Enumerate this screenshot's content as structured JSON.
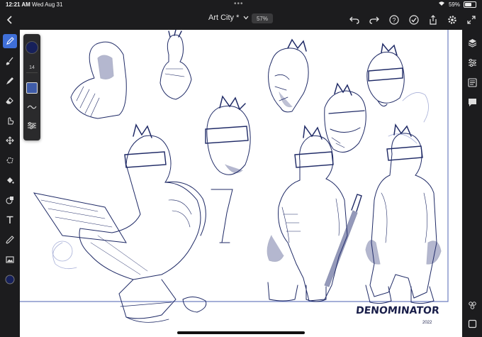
{
  "status_bar": {
    "time": "12:21 AM",
    "date": "Wed Aug 31",
    "battery": "59%",
    "battery_level": 0.59
  },
  "document": {
    "title": "Art City *",
    "zoom": "57%"
  },
  "brush_panel": {
    "size": "14",
    "color": "#16205a"
  },
  "canvas": {
    "signature": "DENOMINATOR",
    "year": "2022"
  },
  "left_tools": [
    "pen-tool-icon",
    "brush-icon",
    "paint-brush-icon",
    "eraser-icon",
    "smudge-icon",
    "move-icon",
    "lasso-icon",
    "fill-icon",
    "shape-icon",
    "text-icon",
    "eyedropper-icon",
    "image-icon",
    "color-swatch"
  ],
  "right_tools": [
    "layers-icon",
    "adjustments-icon",
    "properties-icon",
    "comments-icon",
    "share-group-icon",
    "frame-icon"
  ],
  "colors": {
    "accent": "#3f6fd8",
    "ink": "#1a1f4a",
    "background": "#1c1c1e"
  }
}
